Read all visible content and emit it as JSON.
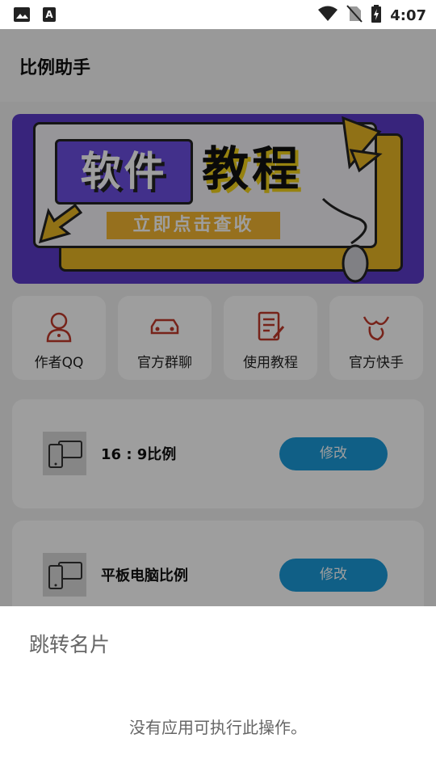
{
  "status_bar": {
    "left_icons": [
      "image-icon",
      "text-a-icon"
    ],
    "right_icons": [
      "wifi-icon",
      "no-sim-icon",
      "battery-charging-icon"
    ],
    "time": "4:07"
  },
  "app_bar": {
    "title": "比例助手"
  },
  "banner": {
    "headline_left": "软件",
    "headline_right": "教程",
    "cta": "立即点击查收",
    "colors": {
      "background": "#5b3bc9",
      "accent": "#e8b624"
    }
  },
  "quick_actions": [
    {
      "label": "作者QQ",
      "icon": "person-icon"
    },
    {
      "label": "官方群聊",
      "icon": "car-icon"
    },
    {
      "label": "使用教程",
      "icon": "document-edit-icon"
    },
    {
      "label": "官方快手",
      "icon": "kuaishou-icon"
    }
  ],
  "ratio_items": [
    {
      "label": "16 : 9比例",
      "button": "修改",
      "icon": "devices-icon"
    },
    {
      "label": "平板电脑比例",
      "button": "修改",
      "icon": "devices-icon"
    }
  ],
  "dialog": {
    "title": "跳转名片",
    "message": "没有应用可执行此操作。"
  },
  "colors": {
    "button": "#1a9ad9",
    "icon_red": "#c0392b"
  }
}
